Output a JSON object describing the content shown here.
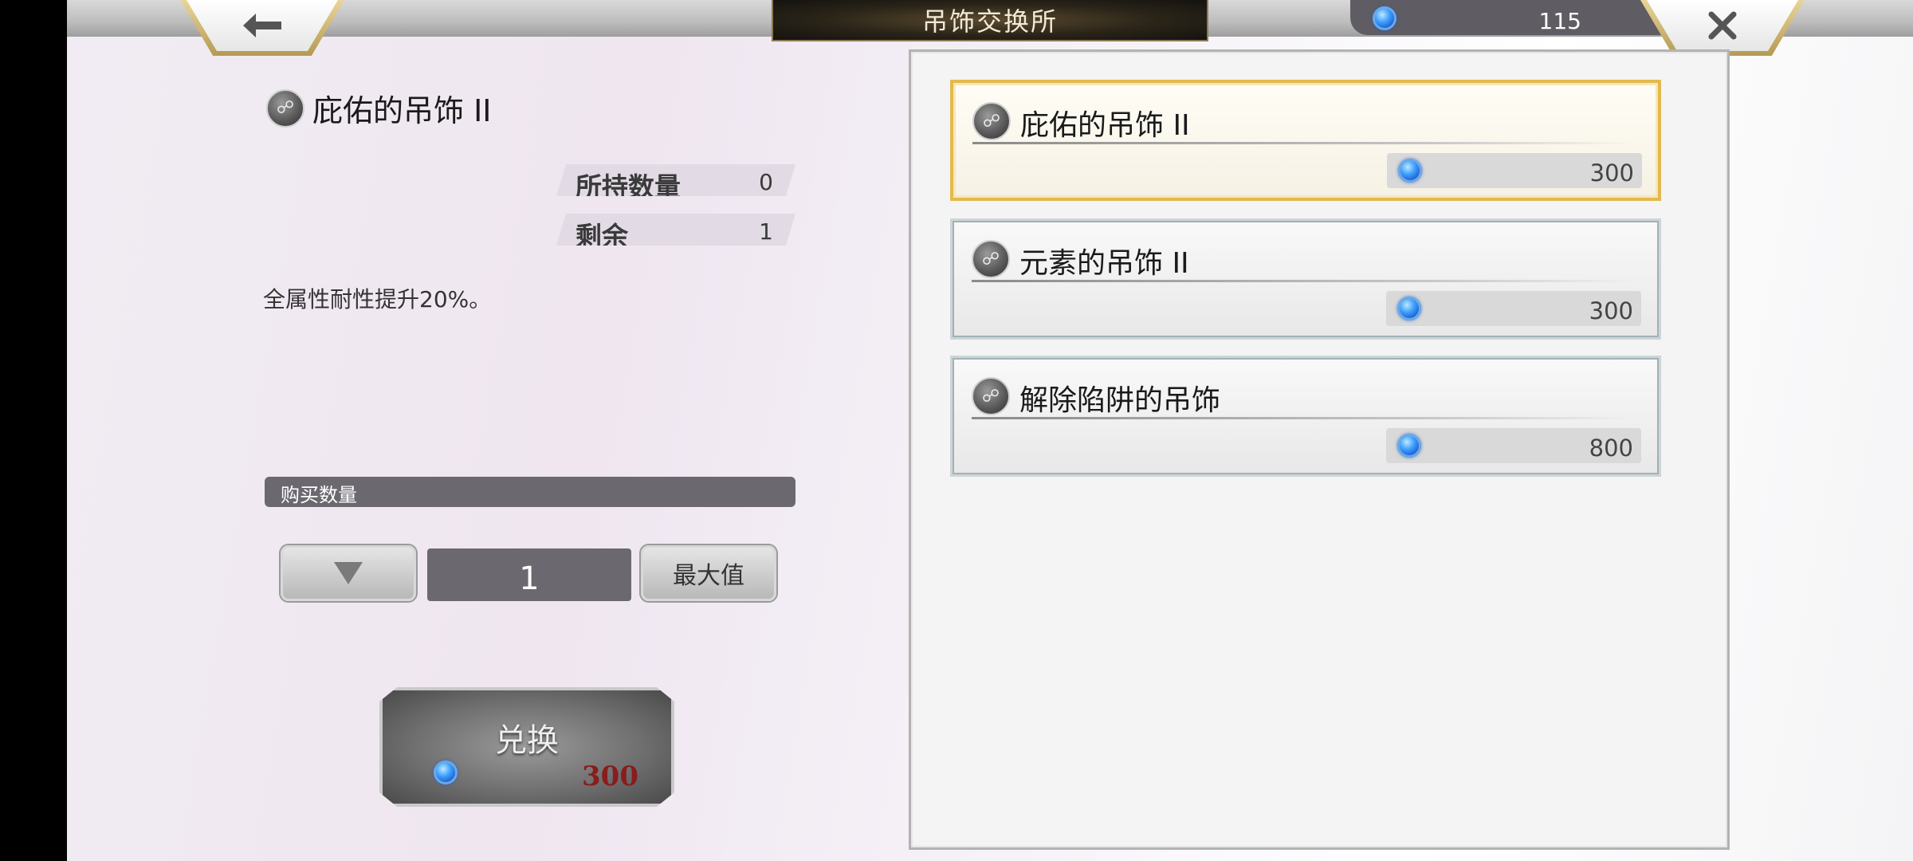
{
  "header": {
    "title": "吊饰交换所",
    "currency_amount": "115"
  },
  "detail": {
    "item_name": "庇佑的吊饰 II",
    "owned_label": "所持数量",
    "owned_value": "0",
    "remaining_label": "剩余",
    "remaining_value": "1",
    "description": "全属性耐性提升20%。",
    "purchase_qty_label": "购买数量",
    "quantity": "1",
    "max_label": "最大值",
    "exchange_label": "兑换",
    "exchange_cost": "300"
  },
  "shop_items": [
    {
      "name": "庇佑的吊饰 II",
      "price": "300"
    },
    {
      "name": "元素的吊饰 II",
      "price": "300"
    },
    {
      "name": "解除陷阱的吊饰",
      "price": "800"
    }
  ],
  "colors": {
    "accent_gold": "#e3b94f",
    "cost_red": "#8a1c1c",
    "gem_blue": "#3ea0ff"
  },
  "icons": {
    "back": "arrow-left-icon",
    "close": "close-icon",
    "currency": "blue-gem-icon",
    "item": "charm-icon",
    "decrease": "triangle-down-icon"
  }
}
